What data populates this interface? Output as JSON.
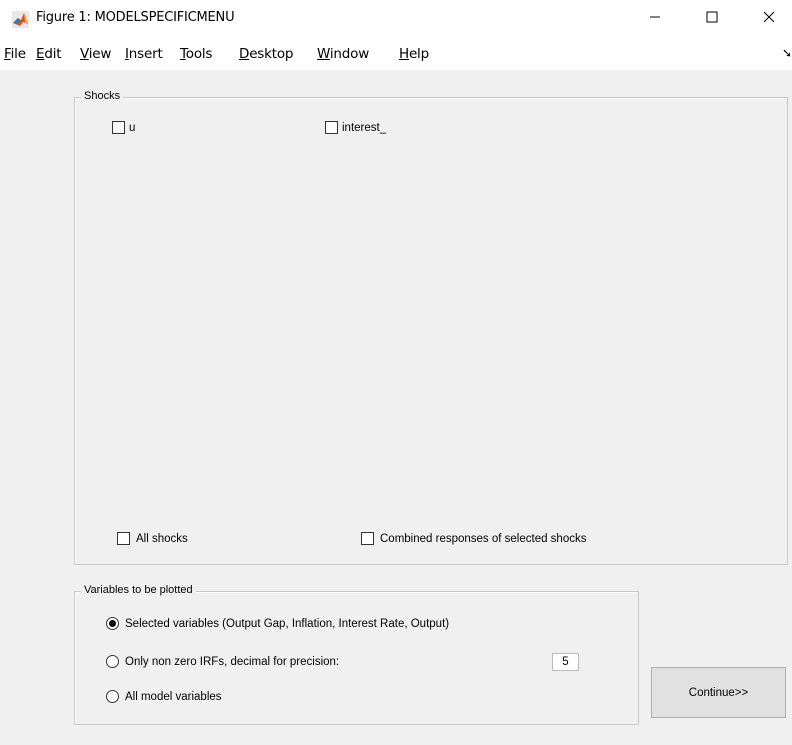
{
  "window": {
    "title": "Figure 1: MODELSPECIFICMENU",
    "app_icon": "matlab-icon",
    "controls": {
      "minimize": "—",
      "maximize": "☐",
      "close": "✕"
    }
  },
  "menubar": {
    "items": [
      "File",
      "Edit",
      "View",
      "Insert",
      "Tools",
      "Desktop",
      "Window",
      "Help"
    ],
    "shortcut_letters": [
      "F",
      "E",
      "V",
      "I",
      "T",
      "D",
      "W",
      "H"
    ],
    "overflow_arrow": "➘"
  },
  "shocks_panel": {
    "title": "Shocks",
    "shocks": [
      {
        "label": "u",
        "checked": false
      },
      {
        "label": "interest_",
        "checked": false
      }
    ],
    "all_shocks": {
      "label": "All shocks",
      "checked": false
    },
    "combined": {
      "label": "Combined responses of selected shocks",
      "checked": false
    }
  },
  "variables_panel": {
    "title": "Variables to be plotted",
    "options": [
      {
        "label": "Selected variables (Output Gap, Inflation, Interest Rate, Output)",
        "selected": true
      },
      {
        "label": "Only non zero IRFs, decimal for precision:",
        "selected": false
      },
      {
        "label": "All model variables",
        "selected": false
      }
    ],
    "precision_value": "5"
  },
  "continue_button": {
    "label": "Continue>>"
  }
}
